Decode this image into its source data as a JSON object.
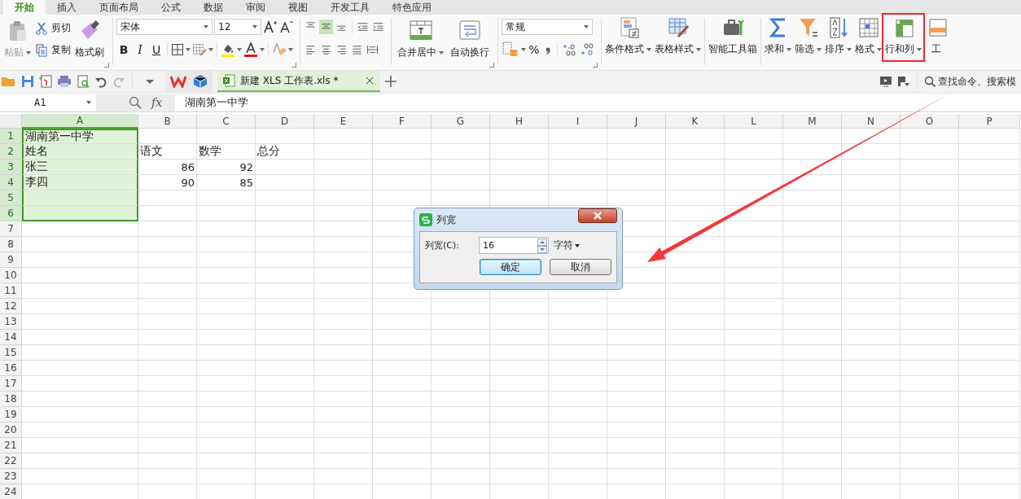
{
  "menu_tabs": [
    {
      "label": "开始",
      "selected": true
    },
    {
      "label": "插入",
      "selected": false
    },
    {
      "label": "页面布局",
      "selected": false
    },
    {
      "label": "公式",
      "selected": false
    },
    {
      "label": "数据",
      "selected": false
    },
    {
      "label": "审阅",
      "selected": false
    },
    {
      "label": "视图",
      "selected": false
    },
    {
      "label": "开发工具",
      "selected": false
    },
    {
      "label": "特色应用",
      "selected": false
    }
  ],
  "clipboard": {
    "paste": {
      "label": "粘贴",
      "disabled": true
    },
    "cut": "剪切",
    "copy": "复制",
    "format_painter": "格式刷"
  },
  "font": {
    "name": "宋体",
    "size": "12",
    "bold": "B",
    "italic": "I",
    "underline": "U"
  },
  "vertical_align": [
    {
      "kind": "top",
      "selected": false
    },
    {
      "kind": "middle",
      "selected": true
    },
    {
      "kind": "bottom",
      "selected": false
    }
  ],
  "merge_center": "合并居中",
  "wrap_text": "自动换行",
  "number": {
    "format": "常规",
    "percent": "%"
  },
  "tools": [
    {
      "kind": "conditional",
      "label": "条件格式",
      "dropdown": true,
      "highlighted": false
    },
    {
      "kind": "table-style",
      "label": "表格样式",
      "dropdown": true,
      "highlighted": false
    },
    {
      "kind": "toolbox",
      "label": "智能工具箱",
      "dropdown": false,
      "highlighted": false
    },
    {
      "kind": "sum",
      "label": "求和",
      "dropdown": true,
      "highlighted": false
    },
    {
      "kind": "filter",
      "label": "筛选",
      "dropdown": true,
      "highlighted": false
    },
    {
      "kind": "sort",
      "label": "排序",
      "dropdown": true,
      "highlighted": false
    },
    {
      "kind": "format",
      "label": "格式",
      "dropdown": true,
      "highlighted": false
    },
    {
      "kind": "rows-cols",
      "label": "行和列",
      "dropdown": true,
      "highlighted": true
    },
    {
      "kind": "sheet",
      "label": "工",
      "dropdown": false,
      "highlighted": false
    }
  ],
  "document_tab": {
    "title": "新建 XLS 工作表.xls *",
    "selected": true
  },
  "search": {
    "placeholder": "查找命令、搜索模"
  },
  "formula_bar": {
    "cell": "A1",
    "fx": "fx",
    "value": "湖南第一中学"
  },
  "sheet": {
    "columns": [
      {
        "label": "A",
        "selected": true
      },
      {
        "label": "B",
        "selected": false
      },
      {
        "label": "C",
        "selected": false
      },
      {
        "label": "D",
        "selected": false
      },
      {
        "label": "E",
        "selected": false
      },
      {
        "label": "F",
        "selected": false
      },
      {
        "label": "G",
        "selected": false
      },
      {
        "label": "H",
        "selected": false
      },
      {
        "label": "I",
        "selected": false
      },
      {
        "label": "J",
        "selected": false
      },
      {
        "label": "K",
        "selected": false
      },
      {
        "label": "L",
        "selected": false
      },
      {
        "label": "M",
        "selected": false
      },
      {
        "label": "N",
        "selected": false
      },
      {
        "label": "O",
        "selected": false
      },
      {
        "label": "P",
        "selected": false
      }
    ],
    "rows": [
      {
        "label": "1",
        "selected": true,
        "cells": [
          {
            "text": "湖南第一中学",
            "kind": "text"
          }
        ]
      },
      {
        "label": "2",
        "selected": true,
        "cells": [
          {
            "text": "姓名",
            "kind": "text"
          },
          {
            "text": "语文",
            "kind": "text"
          },
          {
            "text": "数学",
            "kind": "text"
          },
          {
            "text": "总分",
            "kind": "text"
          }
        ]
      },
      {
        "label": "3",
        "selected": true,
        "cells": [
          {
            "text": "张三",
            "kind": "text"
          },
          {
            "text": "86",
            "kind": "number"
          },
          {
            "text": "92",
            "kind": "number"
          }
        ]
      },
      {
        "label": "4",
        "selected": true,
        "cells": [
          {
            "text": "李四",
            "kind": "text"
          },
          {
            "text": "90",
            "kind": "number"
          },
          {
            "text": "85",
            "kind": "number"
          }
        ]
      },
      {
        "label": "5",
        "selected": true
      },
      {
        "label": "6",
        "selected": true
      },
      {
        "label": "7",
        "selected": false
      },
      {
        "label": "8",
        "selected": false
      },
      {
        "label": "9",
        "selected": false
      },
      {
        "label": "10",
        "selected": false
      },
      {
        "label": "11",
        "selected": false
      },
      {
        "label": "12",
        "selected": false
      },
      {
        "label": "13",
        "selected": false
      },
      {
        "label": "14",
        "selected": false
      },
      {
        "label": "15",
        "selected": false
      },
      {
        "label": "16",
        "selected": false
      },
      {
        "label": "17",
        "selected": false
      },
      {
        "label": "18",
        "selected": false
      },
      {
        "label": "19",
        "selected": false
      },
      {
        "label": "20",
        "selected": false
      },
      {
        "label": "21",
        "selected": false
      },
      {
        "label": "22",
        "selected": false
      },
      {
        "label": "23",
        "selected": false
      },
      {
        "label": "24",
        "selected": false
      }
    ]
  },
  "dialog": {
    "title": "列宽",
    "label": "列宽(C):",
    "value": "16",
    "unit": "字符",
    "buttons": [
      {
        "label": "确定",
        "default": true
      },
      {
        "label": "取消",
        "default": false
      }
    ]
  },
  "callout_arrow": true
}
